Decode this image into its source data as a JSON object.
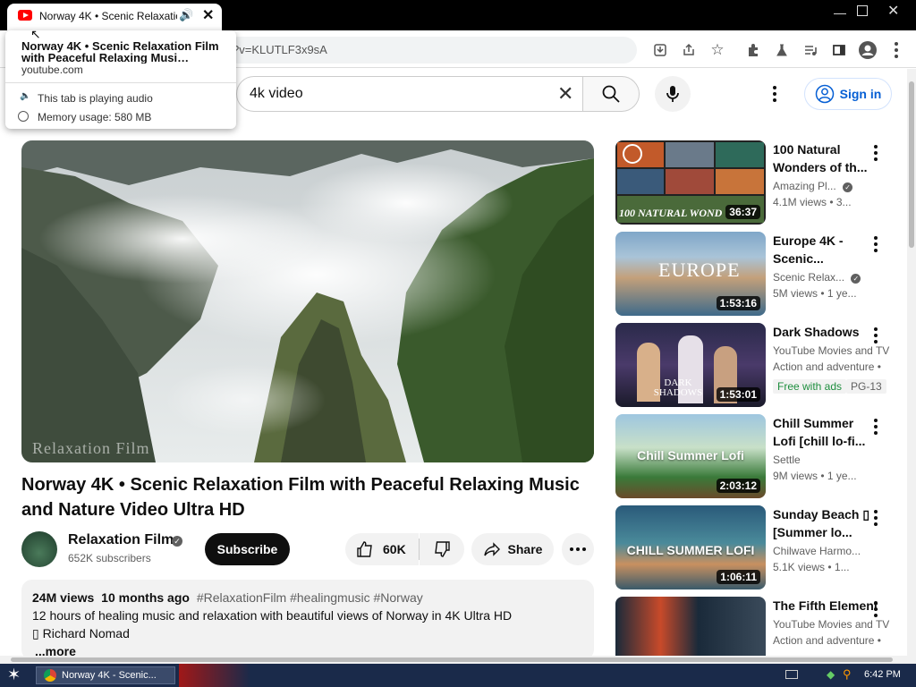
{
  "browser": {
    "tab_title": "Norway 4K • Scenic Relaxation",
    "url_fragment": "?v=KLUTLF3x9sA",
    "hovercard": {
      "title": "Norway 4K • Scenic Relaxation Film with Peaceful Relaxing Musi…",
      "domain": "youtube.com",
      "audio": "This tab is playing audio",
      "memory": "Memory usage: 580 MB"
    }
  },
  "youtube": {
    "search_value": "4k video",
    "sign_in": "Sign in",
    "video": {
      "title": "Norway 4K • Scenic Relaxation Film with Peaceful Relaxing Music and Nature Video Ultra HD",
      "watermark": "Relaxation Film",
      "channel": "Relaxation Film",
      "subscribers": "652K subscribers",
      "subscribe": "Subscribe",
      "likes": "60K",
      "share": "Share",
      "description": {
        "views": "24M views",
        "age": "10 months ago",
        "tags": "#RelaxationFilm #healingmusic #Norway",
        "line1": "12 hours of healing music and relaxation with beautiful views of Norway in 4K Ultra HD",
        "line2": "▯ Richard Nomad",
        "more": "...more"
      }
    },
    "recommendations": [
      {
        "title": "100 Natural Wonders of th...",
        "channel": "Amazing Pl...",
        "verified": true,
        "meta": "4.1M views  • 3...",
        "duration": "36:37",
        "overlay": "100 NATURAL WOND"
      },
      {
        "title": "Europe 4K - Scenic...",
        "channel": "Scenic Relax...",
        "verified": true,
        "meta": "5M views  • 1 ye...",
        "duration": "1:53:16",
        "overlay": "EUROPE"
      },
      {
        "title": "Dark Shadows",
        "channel": "YouTube Movies and TV",
        "meta": "Action and adventure •",
        "badge1": "Free with ads",
        "badge2": "PG-13",
        "duration": "1:53:01",
        "overlay": "DARK SHADOWS"
      },
      {
        "title": "Chill Summer Lofi [chill lo-fi...",
        "channel": "Settle",
        "meta": "9M views  • 1 ye...",
        "duration": "2:03:12",
        "overlay": "Chill Summer Lofi"
      },
      {
        "title": "Sunday Beach ▯ [Summer lo...",
        "channel": "Chilwave Harmo...",
        "meta": "5.1K views  • 1...",
        "duration": "1:06:11",
        "overlay": "CHILL SUMMER LOFI"
      },
      {
        "title": "The Fifth Element",
        "channel": "YouTube Movies and TV",
        "meta": "Action and adventure •"
      }
    ]
  },
  "taskbar": {
    "app_label": "Norway 4K - Scenic...",
    "time": "6:42 PM"
  }
}
